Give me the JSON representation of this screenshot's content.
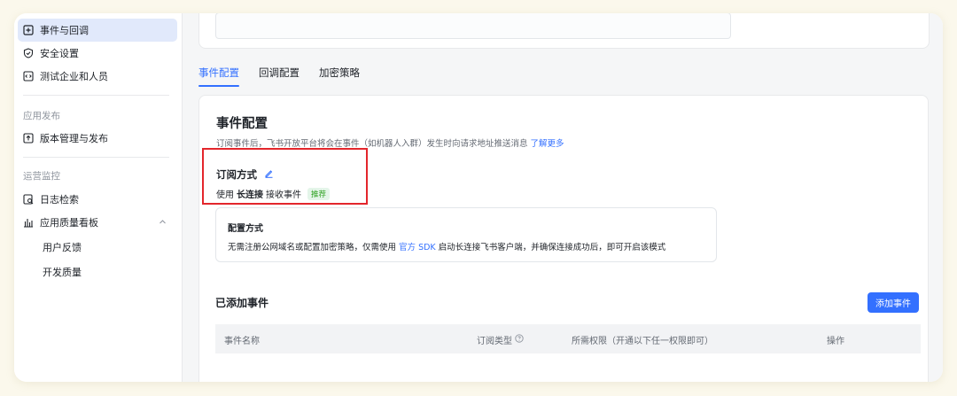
{
  "sidebar": {
    "items": [
      {
        "label": "事件与回调",
        "icon": "event-callback-icon",
        "active": true
      },
      {
        "label": "安全设置",
        "icon": "shield-icon"
      },
      {
        "label": "测试企业和人员",
        "icon": "code-icon"
      }
    ],
    "group_publish": "应用发布",
    "publish_item": {
      "label": "版本管理与发布",
      "icon": "upload-icon"
    },
    "group_monitor": "运营监控",
    "monitor_items": [
      {
        "label": "日志检索",
        "icon": "log-search-icon"
      },
      {
        "label": "应用质量看板",
        "icon": "bar-chart-icon"
      }
    ],
    "sub_items": [
      "用户反馈",
      "开发质量"
    ]
  },
  "tabs": [
    "事件配置",
    "回调配置",
    "加密策略"
  ],
  "panel": {
    "title": "事件配置",
    "desc": "订阅事件后，飞书开放平台将会在事件（如机器人入群）发生时向请求地址推送消息",
    "learn_more": "了解更多",
    "sub_title": "订阅方式",
    "sub_prefix": "使用",
    "sub_bold": "长连接",
    "sub_suffix": "接收事件",
    "badge": "推荐",
    "info_title": "配置方式",
    "info_prefix": "无需注册公网域名或配置加密策略，仅需使用",
    "info_link": "官方 SDK",
    "info_suffix": "启动长连接飞书客户端，并确保连接成功后，即可开启该模式",
    "added_title": "已添加事件",
    "add_button": "添加事件",
    "columns": [
      "事件名称",
      "订阅类型",
      "所需权限（开通以下任一权限即可）",
      "操作"
    ]
  },
  "colors": {
    "accent": "#3370ff",
    "highlight": "#e3262c",
    "badge_bg": "#e4f5e9",
    "badge_text": "#2ea121"
  }
}
